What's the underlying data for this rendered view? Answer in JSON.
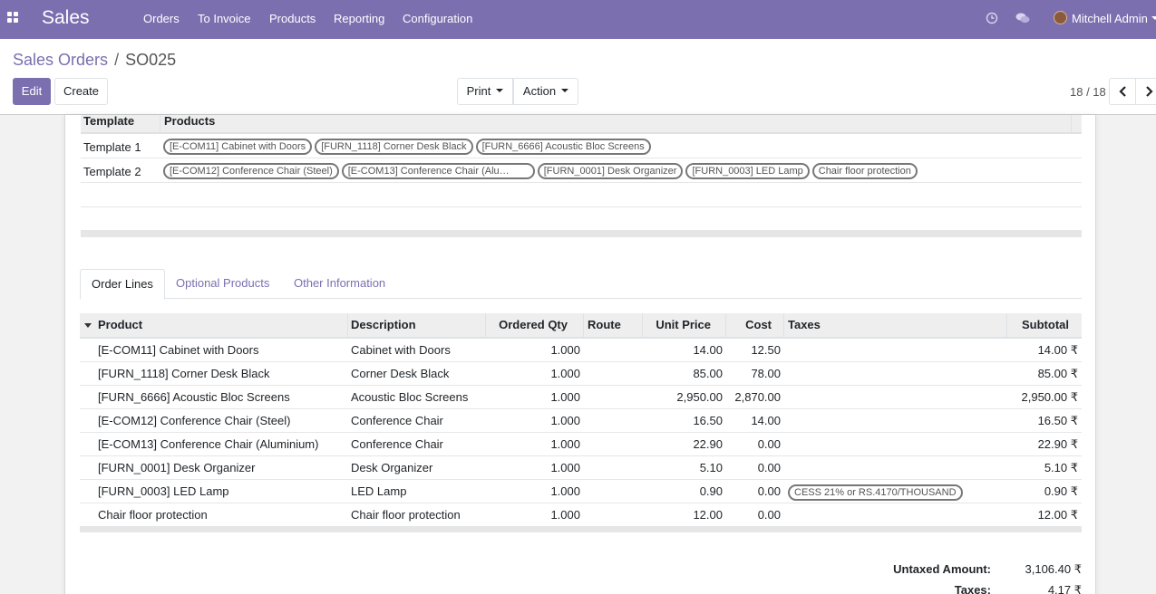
{
  "navbar": {
    "app_name": "Sales",
    "menu": [
      "Orders",
      "To Invoice",
      "Products",
      "Reporting",
      "Configuration"
    ],
    "user": "Mitchell Admin",
    "icons": [
      "apps-icon",
      "clock-icon",
      "chat-icon",
      "avatar",
      "chevron-down-icon"
    ],
    "color": "#7c6fb0"
  },
  "breadcrumb": {
    "parent": "Sales Orders",
    "separator": "/",
    "current": "SO025"
  },
  "buttons": {
    "edit": "Edit",
    "create": "Create",
    "print": "Print",
    "action": "Action"
  },
  "pager": {
    "value": "18 / 18"
  },
  "templates": {
    "headers": [
      "Template",
      "Products"
    ],
    "rows": [
      {
        "name": "Template 1",
        "tags": [
          "[E-COM11] Cabinet with Doors",
          "[FURN_1118] Corner Desk Black",
          "[FURN_6666] Acoustic Bloc Screens"
        ]
      },
      {
        "name": "Template 2",
        "tags": [
          "[E-COM12] Conference Chair (Steel)",
          "[E-COM13] Conference Chair (Alu…",
          "[FURN_0001] Desk Organizer",
          "[FURN_0003] LED Lamp",
          "Chair floor protection"
        ]
      }
    ]
  },
  "tabs": [
    "Order Lines",
    "Optional Products",
    "Other Information"
  ],
  "order_lines": {
    "headers": [
      "Product",
      "Description",
      "Ordered Qty",
      "Route",
      "Unit Price",
      "Cost",
      "Taxes",
      "Subtotal"
    ],
    "rows": [
      {
        "product": "[E-COM11] Cabinet with Doors",
        "description": "Cabinet with Doors",
        "qty": "1.000",
        "route": "",
        "price": "14.00",
        "cost": "12.50",
        "taxes": "",
        "subtotal": "14.00 ₹"
      },
      {
        "product": "[FURN_1118] Corner Desk Black",
        "description": "Corner Desk Black",
        "qty": "1.000",
        "route": "",
        "price": "85.00",
        "cost": "78.00",
        "taxes": "",
        "subtotal": "85.00 ₹"
      },
      {
        "product": "[FURN_6666] Acoustic Bloc Screens",
        "description": "Acoustic Bloc Screens",
        "qty": "1.000",
        "route": "",
        "price": "2,950.00",
        "cost": "2,870.00",
        "taxes": "",
        "subtotal": "2,950.00 ₹"
      },
      {
        "product": "[E-COM12] Conference Chair (Steel)",
        "description": "Conference Chair",
        "qty": "1.000",
        "route": "",
        "price": "16.50",
        "cost": "14.00",
        "taxes": "",
        "subtotal": "16.50 ₹"
      },
      {
        "product": "[E-COM13] Conference Chair (Aluminium)",
        "description": "Conference Chair",
        "qty": "1.000",
        "route": "",
        "price": "22.90",
        "cost": "0.00",
        "taxes": "",
        "subtotal": "22.90 ₹"
      },
      {
        "product": "[FURN_0001] Desk Organizer",
        "description": "Desk Organizer",
        "qty": "1.000",
        "route": "",
        "price": "5.10",
        "cost": "0.00",
        "taxes": "",
        "subtotal": "5.10 ₹"
      },
      {
        "product": "[FURN_0003] LED Lamp",
        "description": "LED Lamp",
        "qty": "1.000",
        "route": "",
        "price": "0.90",
        "cost": "0.00",
        "taxes": "CESS 21% or RS.4170/THOUSAND",
        "subtotal": "0.90 ₹"
      },
      {
        "product": "Chair floor protection",
        "description": "Chair floor protection",
        "qty": "1.000",
        "route": "",
        "price": "12.00",
        "cost": "0.00",
        "taxes": "",
        "subtotal": "12.00 ₹"
      }
    ]
  },
  "totals": {
    "untaxed_label": "Untaxed Amount:",
    "untaxed_value": "3,106.40 ₹",
    "taxes_label": "Taxes:",
    "taxes_value": "4.17 ₹"
  }
}
